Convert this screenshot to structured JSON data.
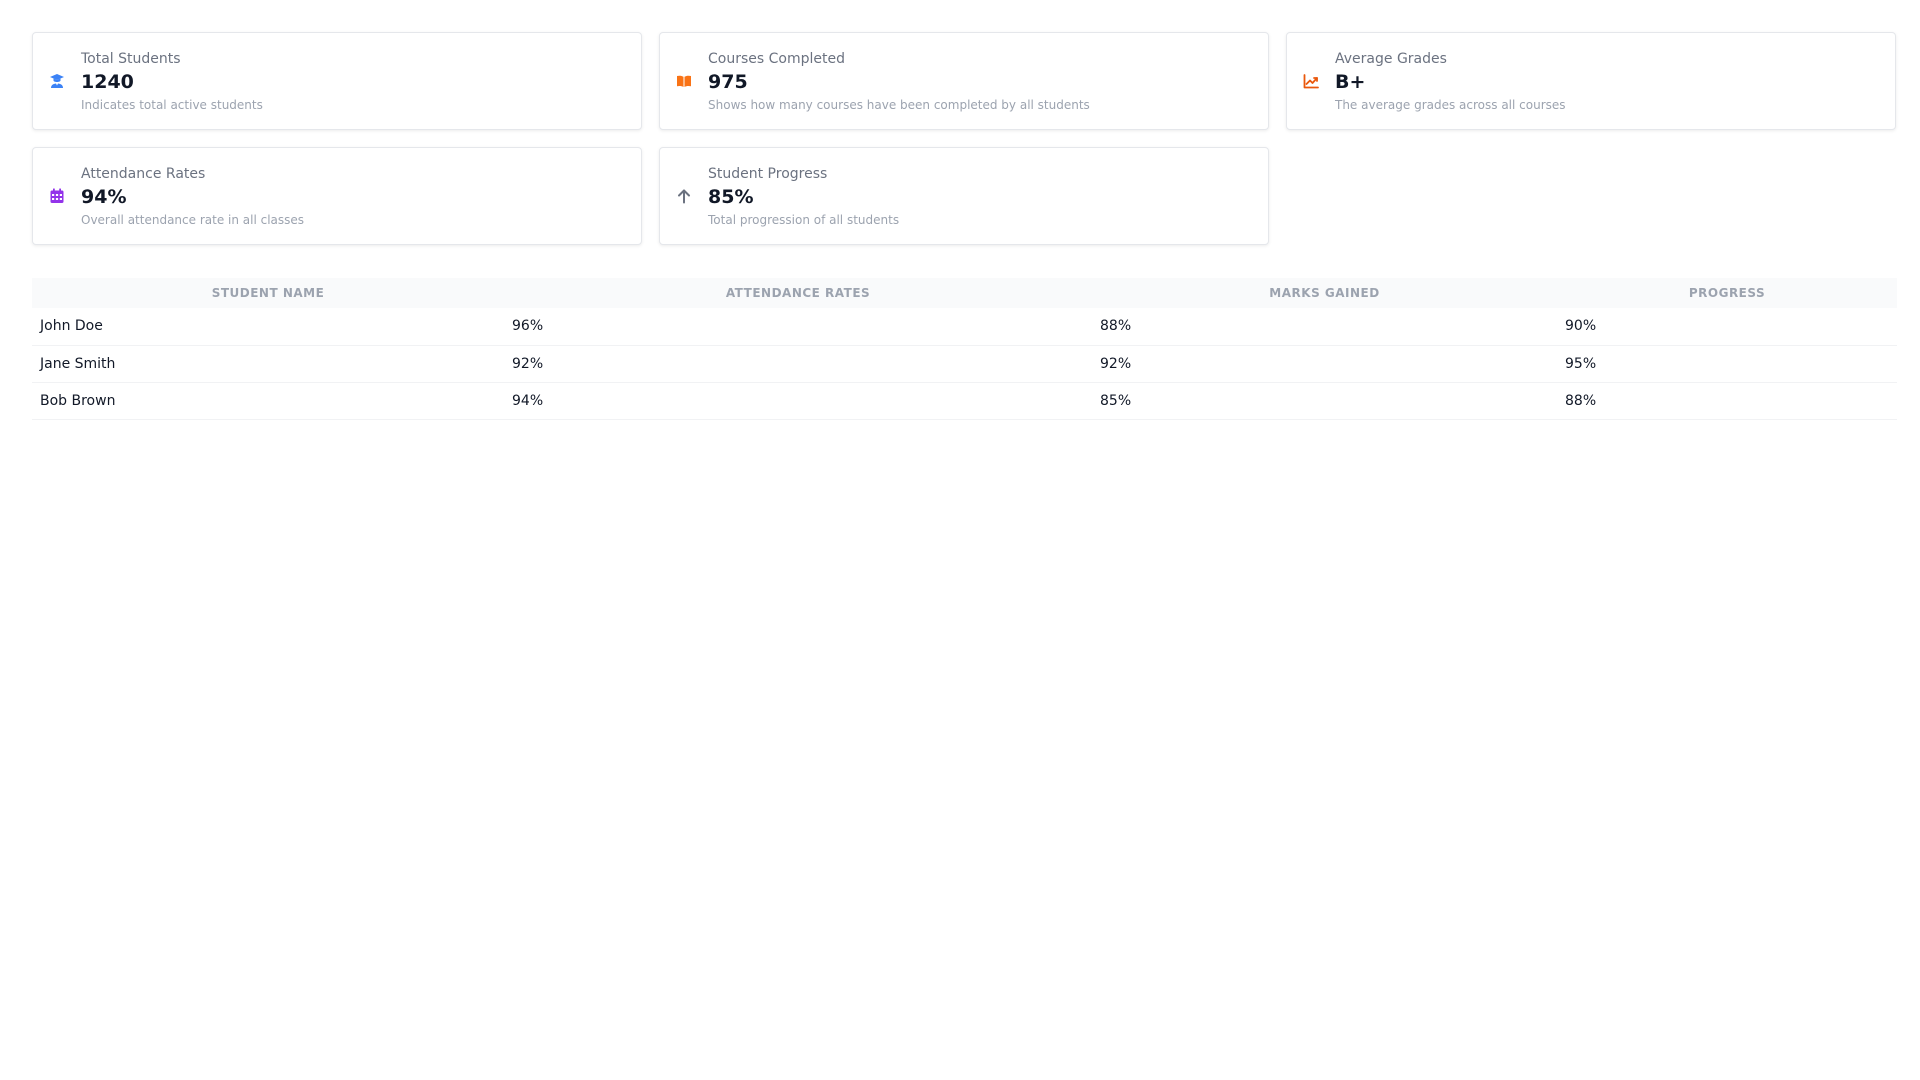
{
  "cards": [
    {
      "label": "Total Students",
      "value": "1240",
      "desc": "Indicates total active students",
      "icon": "graduate-icon",
      "color": "#3b82f6"
    },
    {
      "label": "Courses Completed",
      "value": "975",
      "desc": "Shows how many courses have been completed by all students",
      "icon": "book-open-icon",
      "color": "#f97316"
    },
    {
      "label": "Average Grades",
      "value": "B+",
      "desc": "The average grades across all courses",
      "icon": "chart-line-icon",
      "color": "#ea580c"
    },
    {
      "label": "Attendance Rates",
      "value": "94%",
      "desc": "Overall attendance rate in all classes",
      "icon": "calendar-icon",
      "color": "#9333ea"
    },
    {
      "label": "Student Progress",
      "value": "85%",
      "desc": "Total progression of all students",
      "icon": "arrow-up-icon",
      "color": "#6b7280"
    }
  ],
  "table": {
    "headers": [
      "STUDENT NAME",
      "ATTENDANCE RATES",
      "MARKS GAINED",
      "PROGRESS"
    ],
    "rows": [
      {
        "name": "John Doe",
        "attendance": "96%",
        "marks": "88%",
        "progress": "90%"
      },
      {
        "name": "Jane Smith",
        "attendance": "92%",
        "marks": "92%",
        "progress": "95%"
      },
      {
        "name": "Bob Brown",
        "attendance": "94%",
        "marks": "85%",
        "progress": "88%"
      }
    ]
  }
}
